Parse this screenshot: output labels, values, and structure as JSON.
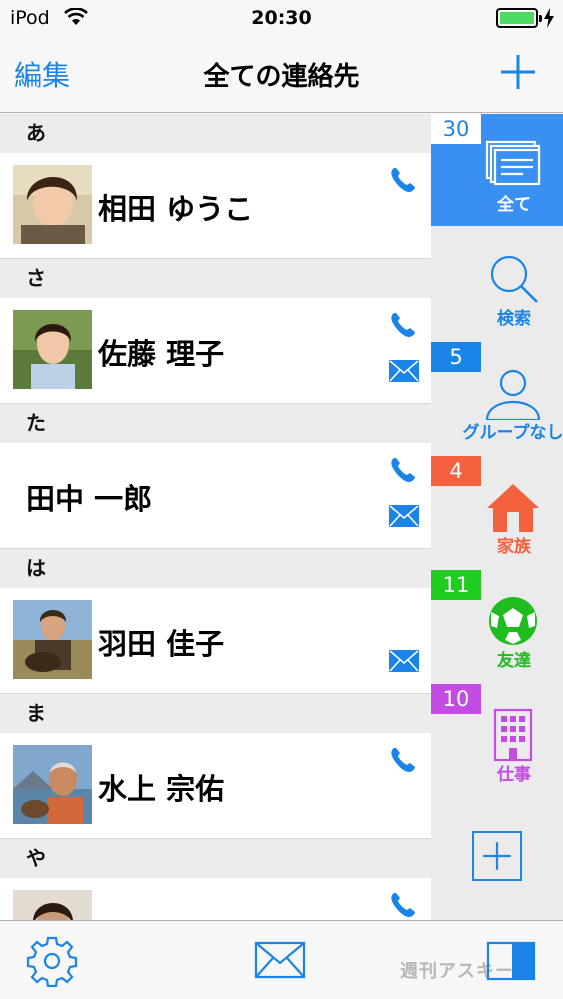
{
  "status_bar": {
    "carrier": "iPod",
    "time": "20:30",
    "battery_color": "#4cd964"
  },
  "nav": {
    "edit_label": "編集",
    "title": "全ての連絡先",
    "add_icon": "plus-icon"
  },
  "sections": [
    {
      "header": "あ",
      "contacts": [
        {
          "name": "相田 ゆうこ",
          "avatar": true,
          "phone": true,
          "mail": false
        }
      ]
    },
    {
      "header": "さ",
      "contacts": [
        {
          "name": "佐藤 理子",
          "avatar": true,
          "phone": true,
          "mail": true
        }
      ]
    },
    {
      "header": "た",
      "contacts": [
        {
          "name": "田中 一郎",
          "avatar": false,
          "phone": true,
          "mail": true
        }
      ]
    },
    {
      "header": "は",
      "contacts": [
        {
          "name": "羽田 佳子",
          "avatar": true,
          "phone": false,
          "mail": true
        }
      ]
    },
    {
      "header": "ま",
      "contacts": [
        {
          "name": "水上 宗佑",
          "avatar": true,
          "phone": true,
          "mail": false
        }
      ]
    },
    {
      "header": "や",
      "contacts": [
        {
          "name": "",
          "avatar": true,
          "phone": true,
          "mail": false
        }
      ]
    }
  ],
  "groups": [
    {
      "label": "全て",
      "count": "30",
      "badge_color": "#1a84e8",
      "label_color": "#ffffff",
      "icon": "cards-icon",
      "active": true
    },
    {
      "label": "検索",
      "count": "",
      "badge_color": "",
      "label_color": "#1a84e8",
      "icon": "search-icon",
      "active": false
    },
    {
      "label": "グループなし",
      "count": "5",
      "badge_color": "#1a84e8",
      "label_color": "#1a84e8",
      "icon": "person-icon",
      "active": false
    },
    {
      "label": "家族",
      "count": "4",
      "badge_color": "#f4613f",
      "label_color": "#f4613f",
      "icon": "house-icon",
      "active": false
    },
    {
      "label": "友達",
      "count": "11",
      "badge_color": "#1fcc1f",
      "label_color": "#1fbb1f",
      "icon": "soccer-ball-icon",
      "active": false
    },
    {
      "label": "仕事",
      "count": "10",
      "badge_color": "#c44be3",
      "label_color": "#c44be3",
      "icon": "building-icon",
      "active": false
    }
  ],
  "toolbar": {
    "settings_icon": "gear-icon",
    "mail_icon": "envelope-icon",
    "layout_icon": "split-view-icon",
    "watermark": "週刊アスキー"
  },
  "accent_color": "#1a84e8"
}
